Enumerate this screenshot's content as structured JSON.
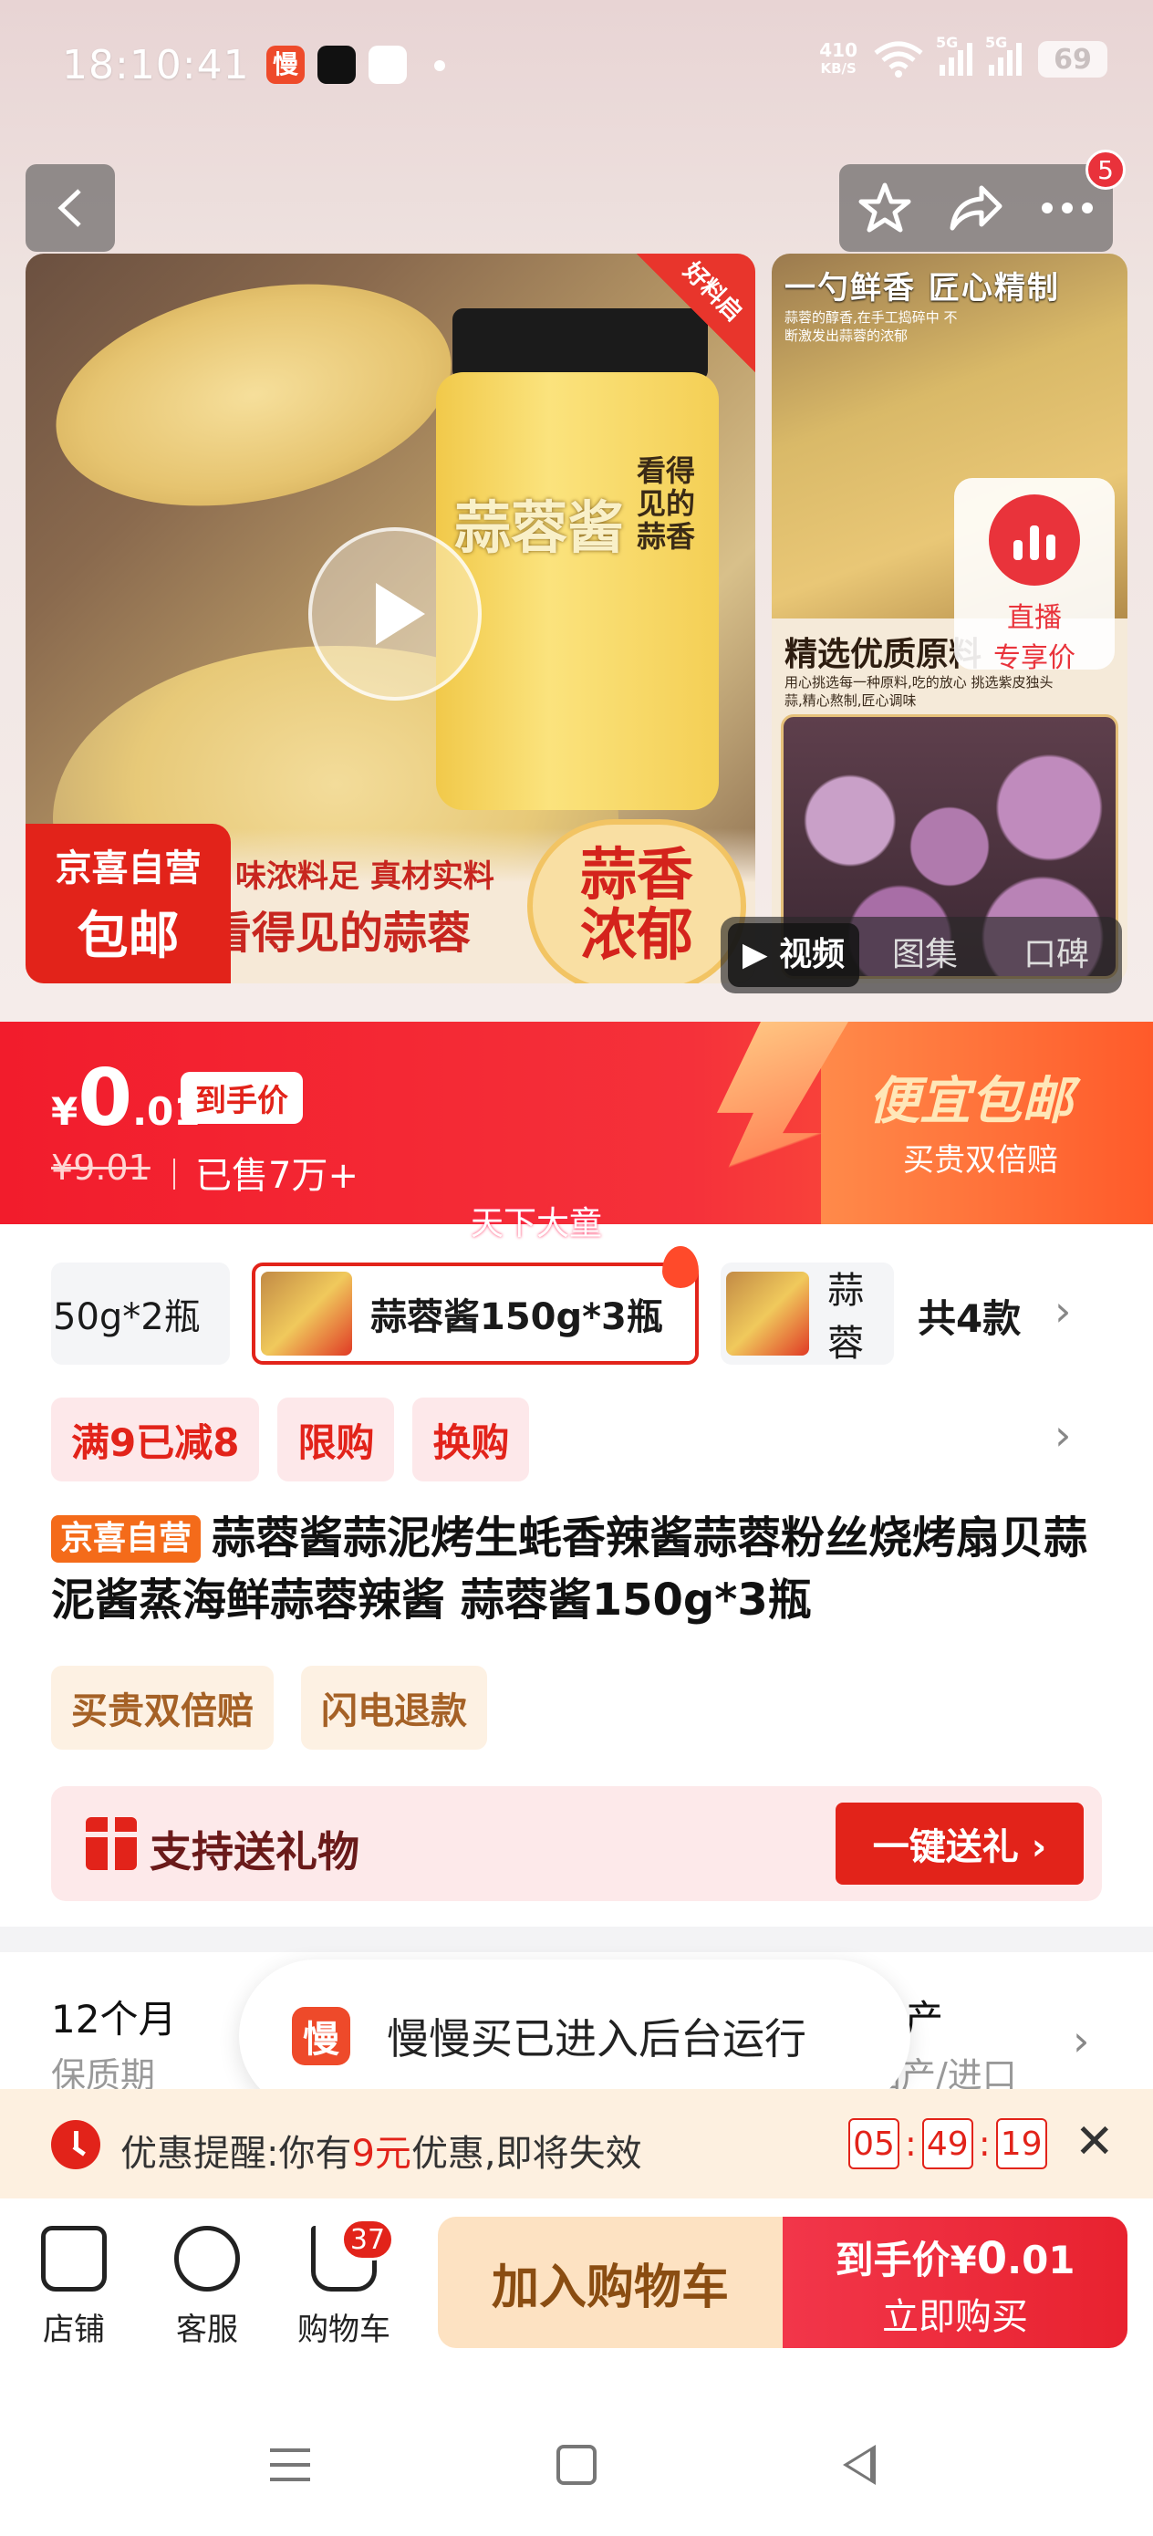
{
  "status_bar": {
    "time": "18:10:41",
    "app_icon_1": "慢",
    "net_speed_value": "410",
    "net_speed_unit": "KB/S",
    "signal_1": "5G",
    "signal_2": "5G",
    "battery": "69"
  },
  "nav": {
    "cart_badge_count": "5"
  },
  "hero": {
    "corner_tag": "好料启",
    "jar_label": "蒜蓉酱",
    "jar_side_label": "看得见的蒜香",
    "banner_line1": "味浓料足 真材实料",
    "banner_line2": "看得见的蒜蓉",
    "jd_badge_line1": "京喜自营",
    "jd_badge_line2": "包邮",
    "aroma_line1": "蒜香",
    "aroma_line2": "浓郁",
    "side_top_title": "一勺鲜香 匠心精制",
    "side_top_small": "蒜蓉的醇香,在手工捣碎中 不断激发出蒜蓉的浓郁",
    "side_mid_title": "精选优质原料",
    "side_mid_small": "用心挑选每一种原料,吃的放心 挑选紫皮独头蒜,精心熬制,匠心调味",
    "live_line1": "直播",
    "live_line2": "专享价",
    "media_tabs": [
      "视频",
      "图集",
      "口碑"
    ]
  },
  "price": {
    "currency": "¥",
    "int_part": "0",
    "dec_part": ".01",
    "tag": "到手价",
    "original": "¥9.01",
    "sold": "已售7万+",
    "free_shipping": "便宜包邮",
    "guarantee": "买贵双倍赔"
  },
  "brand_float": "天下大童",
  "sku": {
    "items": [
      "50g*2瓶",
      "蒜蓉酱150g*3瓶",
      "蒜蓉"
    ],
    "count_label": "共4款"
  },
  "promos": [
    "满9已减8",
    "限购",
    "换购"
  ],
  "product": {
    "badge": "京喜自营",
    "title": "蒜蓉酱蒜泥烤生蚝香辣酱蒜蓉粉丝烧烤扇贝蒜泥酱蒸海鲜蒜蓉辣酱 蒜蓉酱150g*3瓶"
  },
  "services": [
    "买贵双倍赔",
    "闪电退款"
  ],
  "gift": {
    "text": "支持送礼物",
    "button": "一键送礼 ›"
  },
  "specs": {
    "value_1": "12个月",
    "key_1": "保质期",
    "value_2": "国产",
    "key_2": "国产/进口"
  },
  "toast": {
    "icon": "慢",
    "text": "慢慢买已进入后台运行"
  },
  "reminder": {
    "prefix": "优惠提醒:你有",
    "amount": "9元",
    "suffix": "优惠,即将失效",
    "hours": "05",
    "minutes": "49",
    "seconds": "19",
    "sep": ":"
  },
  "actions": {
    "shop": "店铺",
    "service": "客服",
    "cart": "购物车",
    "cart_count": "37",
    "add_to_cart": "加入购物车",
    "buy_price_label": "到手价",
    "buy_currency": "¥",
    "buy_int": "0",
    "buy_dec": ".01",
    "buy_now": "立即购买"
  },
  "colors": {
    "accent_red": "#e2231a",
    "orange_badge": "#f46b1a",
    "promo_bg": "#fde8ea",
    "service_bg": "#fdf1e3"
  }
}
